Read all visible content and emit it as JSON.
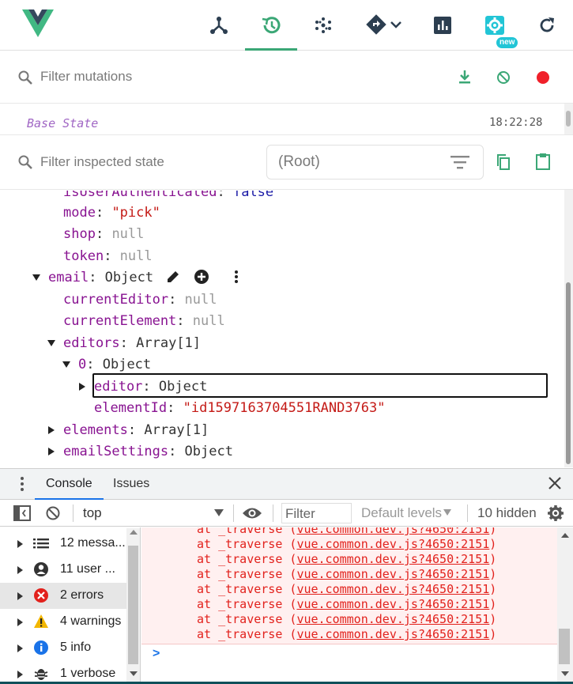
{
  "toolbar": {
    "icons": [
      "components-icon",
      "timeline-icon",
      "vuex-icon",
      "routing-icon",
      "performance-icon",
      "settings-icon",
      "refresh-icon"
    ],
    "new_badge": "new",
    "accent": "#3ba776"
  },
  "mutations": {
    "placeholder": "Filter mutations",
    "base_state": "Base State",
    "base_time": "18:22:28"
  },
  "inspector": {
    "placeholder": "Filter inspected state",
    "root": "(Root)"
  },
  "tree": {
    "r0_key": "isUserAuthenticated",
    "r0_val": "false",
    "r1_key": "mode",
    "r1_val": "\"pick\"",
    "r2_key": "shop",
    "r2_val": "null",
    "r3_key": "token",
    "r3_val": "null",
    "r4_key": "email",
    "r4_val": "Object",
    "r5_key": "currentEditor",
    "r5_val": "null",
    "r6_key": "currentElement",
    "r6_val": "null",
    "r7_key": "editors",
    "r7_val": "Array[1]",
    "r8_key": "0",
    "r8_val": "Object",
    "r9_key": "editor",
    "r9_val": "Object",
    "r10_key": "elementId",
    "r10_val": "\"id1597163704551RAND3763\"",
    "r11_key": "elements",
    "r11_val": "Array[1]",
    "r12_key": "emailSettings",
    "r12_val": "Object"
  },
  "drawer": {
    "tab_console": "Console",
    "tab_issues": "Issues",
    "context": "top",
    "filter_placeholder": "Filter",
    "levels": "Default levels",
    "hidden": "10 hidden"
  },
  "sidebar": {
    "items": [
      {
        "label": "12 messa..."
      },
      {
        "label": "11 user ..."
      },
      {
        "label": "2 errors"
      },
      {
        "label": "4 warnings"
      },
      {
        "label": "5 info"
      },
      {
        "label": "1 verbose"
      }
    ]
  },
  "log": {
    "prefix": "at _traverse (",
    "link": "vue.common.dev.js?4650:2151",
    "suffix": ")",
    "error_color": "#e2211c"
  },
  "prompt": ">"
}
